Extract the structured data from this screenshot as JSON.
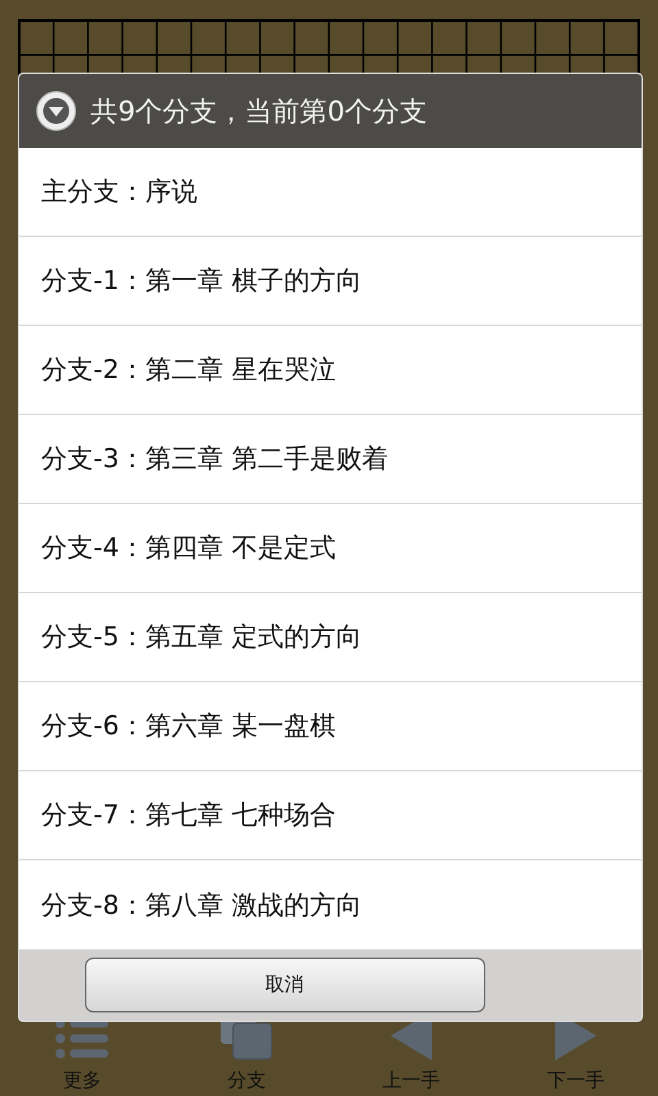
{
  "toolbar": [
    {
      "label": "更多",
      "kind": "more"
    },
    {
      "label": "分支",
      "kind": "branch"
    },
    {
      "label": "上一手",
      "kind": "prev"
    },
    {
      "label": "下一手",
      "kind": "next"
    }
  ],
  "dialog": {
    "title": "共9个分支，当前第0个分支",
    "items": [
      "主分支：序说",
      "分支-1：第一章 棋子的方向",
      "分支-2：第二章 星在哭泣",
      "分支-3：第三章 第二手是败着",
      "分支-4：第四章 不是定式",
      "分支-5：第五章 定式的方向",
      "分支-6：第六章 某一盘棋",
      "分支-7：第七章 七种场合",
      "分支-8：第八章 激战的方向"
    ],
    "buttons": [
      "取消"
    ]
  }
}
